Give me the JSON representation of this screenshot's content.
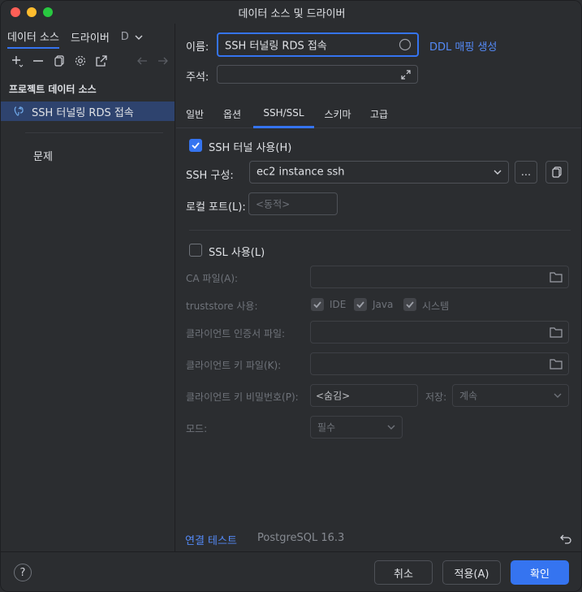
{
  "window": {
    "title": "데이터 소스 및 드라이버"
  },
  "left": {
    "tabs": [
      "데이터 소스",
      "드라이버",
      "D"
    ],
    "section": "프로젝트 데이터 소스",
    "tree_item": "SSH 터널링 RDS 접속",
    "problems": "문제"
  },
  "form": {
    "name_label": "이름:",
    "name_value": "SSH 터널링 RDS 접속",
    "ddl_link": "DDL 매핑 생성",
    "comment_label": "주석:",
    "tabs": [
      "일반",
      "옵션",
      "SSH/SSL",
      "스키마",
      "고급"
    ],
    "ssh_checkbox": "SSH 터널 사용(H)",
    "ssh_config_label": "SSH 구성:",
    "ssh_config_value": "ec2 instance ssh",
    "more_button": "...",
    "local_port_label": "로컬 포트(L):",
    "local_port_placeholder": "<동적>",
    "ssl_checkbox": "SSL 사용(L)",
    "ca_label": "CA 파일(A):",
    "truststore_label": "truststore 사용:",
    "truststore_options": [
      "IDE",
      "Java",
      "시스템"
    ],
    "client_cert_label": "클라이언트 인증서 파일:",
    "client_key_label": "클라이언트 키 파일(K):",
    "client_key_pw_label": "클라이언트 키 비밀번호(P):",
    "client_key_pw_value": "<숨김>",
    "save_label": "저장:",
    "save_value": "계속",
    "mode_label": "모드:",
    "mode_value": "필수"
  },
  "status": {
    "test_connection": "연결 테스트",
    "driver_version": "PostgreSQL 16.3"
  },
  "buttons": {
    "help": "?",
    "cancel": "취소",
    "apply": "적용(A)",
    "ok": "확인"
  },
  "colors": {
    "accent": "#3574f0",
    "link": "#548af7",
    "selection": "#2e436e"
  }
}
